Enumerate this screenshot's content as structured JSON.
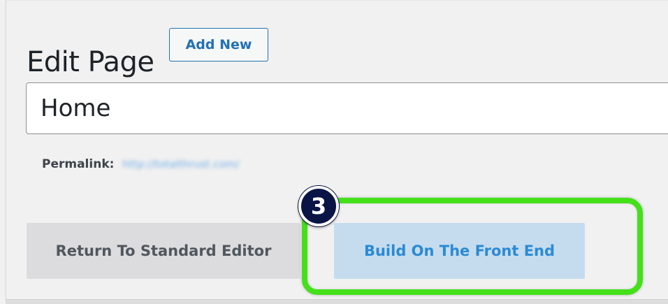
{
  "header": {
    "title": "Edit Page",
    "add_new_label": "Add New"
  },
  "title_field": {
    "value": "Home"
  },
  "permalink": {
    "label": "Permalink:",
    "url": "http://totalthrust.com/"
  },
  "editor_buttons": {
    "standard_label": "Return To Standard Editor",
    "front_end_label": "Build On The Front End"
  },
  "annotation": {
    "step_number": "3",
    "highlight_color": "#44e01a",
    "badge_color": "#0a1445"
  },
  "colors": {
    "link": "#2271b1",
    "front_end_button_bg": "#c5dcef",
    "front_end_button_text": "#2b8ad3",
    "standard_button_bg": "#dcdcde"
  }
}
